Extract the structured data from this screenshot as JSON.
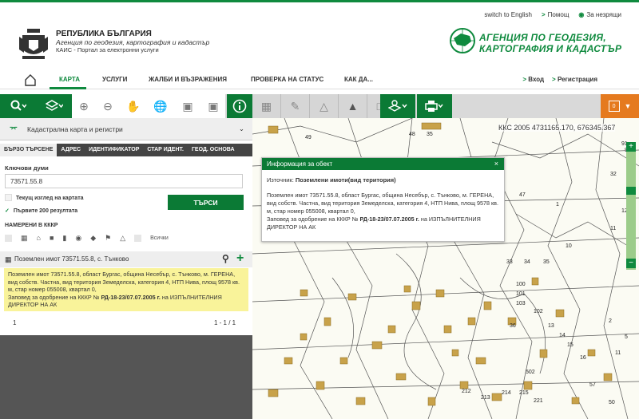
{
  "toplinks": {
    "english": "switch to English",
    "help": "Помощ",
    "visually": "За незрящи"
  },
  "brand": {
    "title": "РЕПУБЛИКА БЪЛГАРИЯ",
    "subtitle": "Агенция по геодезия, картография и кадастър",
    "portal": "КАИС - Портал за електронни услуги",
    "agency_line1": "АГЕНЦИЯ ПО ГЕОДЕЗИЯ,",
    "agency_line2": "КАРТОГРАФИЯ И КАДАСТЪР"
  },
  "nav": {
    "items": [
      "КАРТА",
      "УСЛУГИ",
      "ЖАЛБИ И ВЪЗРАЖЕНИЯ",
      "ПРОВЕРКА НА СТАТУС",
      "КАК ДА..."
    ],
    "login": "Вход",
    "register": "Регистрация"
  },
  "panel": {
    "layer": "Кадастрална карта и регистри",
    "tabs": [
      "БЪРЗО ТЪРСЕНЕ",
      "АДРЕС",
      "ИДЕНТИФИКАТОР",
      "СТАР ИДЕНТ.",
      "ГЕОД. ОСНОВА"
    ],
    "keywords_label": "Ключови думи",
    "keywords_value": "73571.55.8",
    "current_view": "Текущ изглед на картата",
    "first200": "Първите 200 резултата",
    "search_btn": "ТЪРСИ",
    "found_label": "НАМЕРЕНИ В КККР",
    "all_label": "Всички",
    "result_title": "Поземлен имот 73571.55.8, с. Тънково",
    "result_text": "Поземлен имот 73571.55.8, област Бургас, община Несебър, с. Тънково, м. ГЕРЕНА, вид собств. Частна, вид територия Земеделска, категория 4, НТП Нива, площ 9578 кв. м, стар номер 055008, квартал 0,",
    "result_text2": "Заповед за одобрение на КККР № ",
    "result_order": "РД-18-23/07.07.2005 г.",
    "result_text3": " на ИЗПЪЛНИТЕЛНИЯ ДИРЕКТОР НА АК",
    "page_num": "1",
    "page_range": "1 - 1 / 1"
  },
  "map": {
    "coords": "ККС 2005 4731165.170, 676345.367",
    "popup_title": "Информация за обект",
    "popup_source_label": "Източник:",
    "popup_source": "Поземлени имоти(вид територия)",
    "popup_text": "Поземлен имот 73571.55.8, област Бургас, община Несебър, с. Тънково, м. ГЕРЕНА, вид собств. Частна, вид територия Земеделска, категория 4, НТП Нива, площ 9578 кв. м, стар номер 055008, квартал 0,",
    "popup_text2": "Заповед за одобрение на КККР № ",
    "popup_order": "РД-18-23/07.07.2005 г.",
    "popup_text3": " на ИЗПЪЛНИТЕЛНИЯ ДИРЕКТОР НА АК",
    "parcel_labels": [
      "49",
      "48",
      "35",
      "47",
      "1",
      "90",
      "91",
      "32",
      "54",
      "12",
      "11",
      "10",
      "33",
      "34",
      "35",
      "100",
      "101",
      "103",
      "102",
      "36",
      "13",
      "14",
      "15",
      "16",
      "2",
      "5",
      "11",
      "502",
      "215",
      "214",
      "213",
      "212",
      "221",
      "57",
      "50"
    ],
    "badge": "0"
  }
}
